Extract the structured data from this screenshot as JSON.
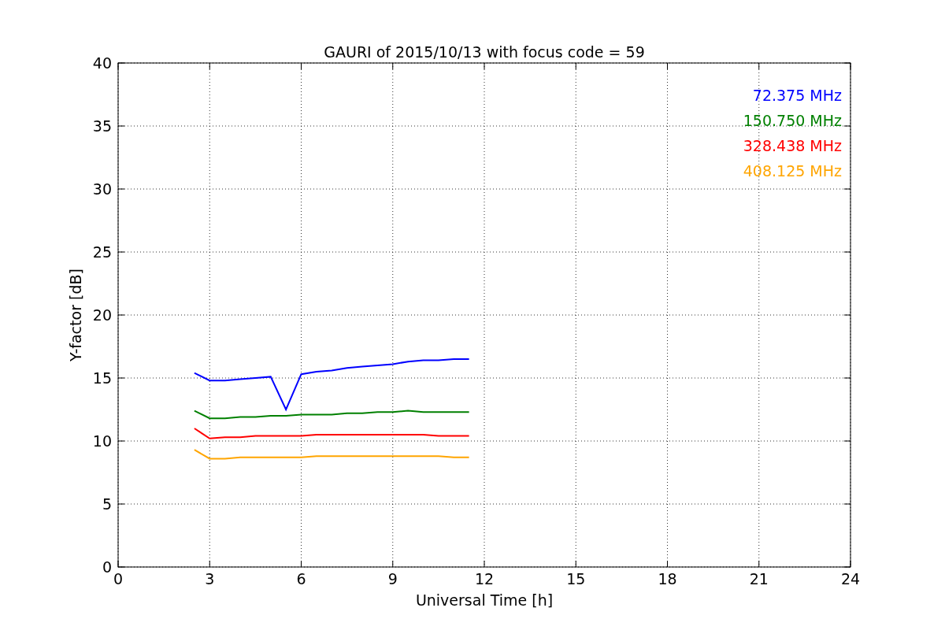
{
  "chart": {
    "chart_data": {
      "type": "line",
      "title": "GAURI of 2015/10/13 with focus code = 59",
      "xlabel": "Universal Time [h]",
      "ylabel": "Y-factor [dB]",
      "x": [
        2.5,
        3,
        3.5,
        4,
        4.5,
        5,
        5.5,
        6,
        6.5,
        7,
        7.5,
        8,
        8.5,
        9,
        9.5,
        10,
        10.5,
        11,
        11.5
      ],
      "series": [
        {
          "name": "72.375 MHz",
          "color": "#0000ff",
          "values": [
            15.4,
            14.8,
            14.8,
            14.9,
            15.0,
            15.1,
            12.5,
            15.3,
            15.5,
            15.6,
            15.8,
            15.9,
            16.0,
            16.1,
            16.3,
            16.4,
            16.4,
            16.5,
            16.5
          ]
        },
        {
          "name": "150.750 MHz",
          "color": "#008000",
          "values": [
            12.4,
            11.8,
            11.8,
            11.9,
            11.9,
            12.0,
            12.0,
            12.1,
            12.1,
            12.1,
            12.2,
            12.2,
            12.3,
            12.3,
            12.4,
            12.3,
            12.3,
            12.3,
            12.3
          ]
        },
        {
          "name": "328.438 MHz",
          "color": "#ff0000",
          "values": [
            11.0,
            10.2,
            10.3,
            10.3,
            10.4,
            10.4,
            10.4,
            10.4,
            10.5,
            10.5,
            10.5,
            10.5,
            10.5,
            10.5,
            10.5,
            10.5,
            10.4,
            10.4,
            10.4
          ]
        },
        {
          "name": "408.125 MHz",
          "color": "#ffa500",
          "values": [
            9.3,
            8.6,
            8.6,
            8.7,
            8.7,
            8.7,
            8.7,
            8.7,
            8.8,
            8.8,
            8.8,
            8.8,
            8.8,
            8.8,
            8.8,
            8.8,
            8.8,
            8.7,
            8.7
          ]
        }
      ],
      "grid": true,
      "xlim": [
        0,
        24
      ],
      "ylim": [
        0,
        40
      ],
      "xticks": [
        0,
        3,
        6,
        9,
        12,
        15,
        18,
        21,
        24
      ],
      "yticks": [
        0,
        5,
        10,
        15,
        20,
        25,
        30,
        35,
        40
      ]
    }
  }
}
